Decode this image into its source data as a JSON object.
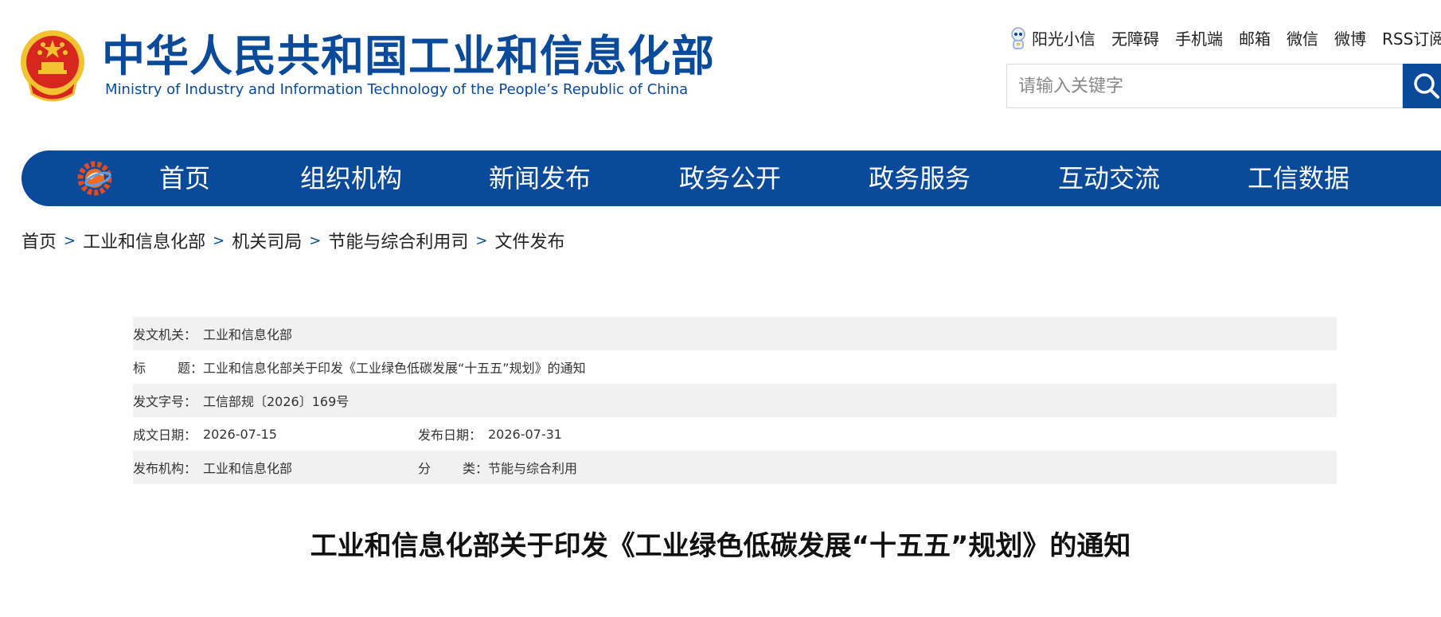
{
  "header": {
    "title_cn": "中华人民共和国工业和信息化部",
    "title_en": "Ministry of Industry and Information Technology of the People’s Republic of China"
  },
  "toplinks": [
    "阳光小信",
    "无障碍",
    "手机端",
    "邮箱",
    "微信",
    "微博",
    "RSS订阅"
  ],
  "search": {
    "placeholder": "请输入关键字",
    "value": ""
  },
  "nav": [
    "首页",
    "组织机构",
    "新闻发布",
    "政务公开",
    "政务服务",
    "互动交流",
    "工信数据"
  ],
  "breadcrumb": [
    "首页",
    "工业和信息化部",
    "机关司局",
    "节能与综合利用司",
    "文件发布"
  ],
  "breadcrumb_sep": ">",
  "info": {
    "issuer_label": "发文机关：",
    "issuer": "工业和信息化部",
    "title_label_a": "标",
    "title_label_b": "题：",
    "title": "工业和信息化部关于印发《工业绿色低碳发展“十五五”规划》的通知",
    "docno_label": "发文字号：",
    "docno": "工信部规〔2026〕169号",
    "written_label": "成文日期：",
    "written": "2026-07-15",
    "published_label": "发布日期：",
    "published": "2026-07-31",
    "org_label": "发布机构：",
    "org": "工业和信息化部",
    "category_label_a": "分",
    "category_label_b": "类：",
    "category": "节能与综合利用"
  },
  "article": {
    "title": "工业和信息化部关于印发《工业绿色低碳发展“十五五”规划》的通知"
  },
  "colors": {
    "brand_blue": "#0a4a9b",
    "row_shade": "#f1f1f1",
    "emblem_red": "#d7261e",
    "emblem_gold": "#f2c230"
  },
  "icons": [
    "national-emblem-icon",
    "robot-mascot-icon",
    "search-icon",
    "gear-globe-logo-icon"
  ]
}
